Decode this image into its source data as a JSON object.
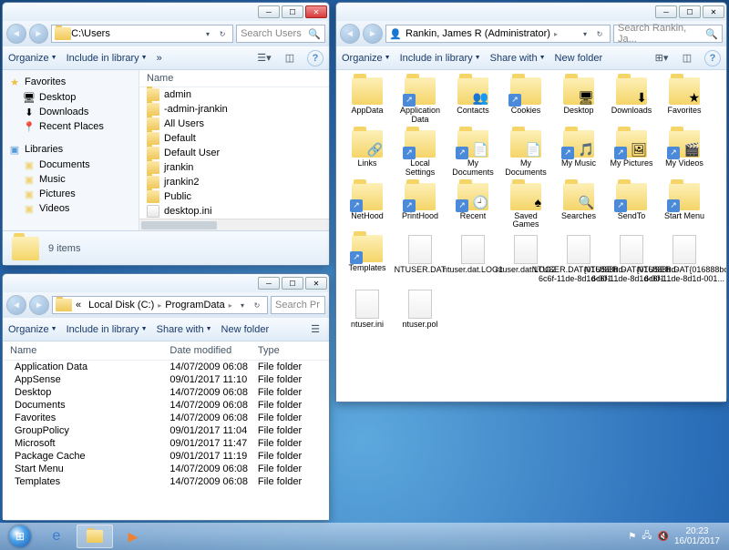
{
  "win1": {
    "address": "C:\\Users",
    "search_placeholder": "Search Users",
    "toolbar": {
      "organize": "Organize",
      "include": "Include in library",
      "more": "»"
    },
    "nav": {
      "favorites": "Favorites",
      "fav_items": [
        "Desktop",
        "Downloads",
        "Recent Places"
      ],
      "libraries": "Libraries",
      "lib_items": [
        "Documents",
        "Music",
        "Pictures",
        "Videos"
      ]
    },
    "header": "Name",
    "items": [
      "admin",
      "-admin-jrankin",
      "All Users",
      "Default",
      "Default User",
      "jrankin",
      "jrankin2",
      "Public",
      "desktop.ini"
    ],
    "status": "9 items"
  },
  "win2": {
    "crumbs": [
      "Local Disk (C:)",
      "ProgramData"
    ],
    "search_placeholder": "Search Pr",
    "toolbar": {
      "organize": "Organize",
      "include": "Include in library",
      "share": "Share with",
      "newfolder": "New folder"
    },
    "columns": [
      "Name",
      "Date modified",
      "Type"
    ],
    "rows": [
      {
        "n": "Application Data",
        "d": "14/07/2009 06:08",
        "t": "File folder"
      },
      {
        "n": "AppSense",
        "d": "09/01/2017 11:10",
        "t": "File folder"
      },
      {
        "n": "Desktop",
        "d": "14/07/2009 06:08",
        "t": "File folder"
      },
      {
        "n": "Documents",
        "d": "14/07/2009 06:08",
        "t": "File folder"
      },
      {
        "n": "Favorites",
        "d": "14/07/2009 06:08",
        "t": "File folder"
      },
      {
        "n": "GroupPolicy",
        "d": "09/01/2017 11:04",
        "t": "File folder"
      },
      {
        "n": "Microsoft",
        "d": "09/01/2017 11:47",
        "t": "File folder"
      },
      {
        "n": "Package Cache",
        "d": "09/01/2017 11:19",
        "t": "File folder"
      },
      {
        "n": "Start Menu",
        "d": "14/07/2009 06:08",
        "t": "File folder"
      },
      {
        "n": "Templates",
        "d": "14/07/2009 06:08",
        "t": "File folder"
      }
    ]
  },
  "win3": {
    "crumbs": [
      "Rankin, James R (Administrator)"
    ],
    "search_placeholder": "Search Rankin, Ja...",
    "toolbar": {
      "organize": "Organize",
      "include": "Include in library",
      "share": "Share with",
      "newfolder": "New folder"
    },
    "items": [
      {
        "n": "AppData",
        "k": "folder"
      },
      {
        "n": "Application Data",
        "k": "folder",
        "s": true
      },
      {
        "n": "Contacts",
        "k": "folder",
        "b": "👥"
      },
      {
        "n": "Cookies",
        "k": "folder",
        "s": true
      },
      {
        "n": "Desktop",
        "k": "folder",
        "b": "🖥"
      },
      {
        "n": "Downloads",
        "k": "folder",
        "b": "⬇"
      },
      {
        "n": "Favorites",
        "k": "folder",
        "b": "★"
      },
      {
        "n": "Links",
        "k": "folder",
        "b": "🔗"
      },
      {
        "n": "Local Settings",
        "k": "folder",
        "s": true
      },
      {
        "n": "My Documents",
        "k": "folder",
        "s": true,
        "b": "📄"
      },
      {
        "n": "My Documents",
        "k": "folder",
        "b": "📄"
      },
      {
        "n": "My Music",
        "k": "folder",
        "s": true,
        "b": "🎵"
      },
      {
        "n": "My Pictures",
        "k": "folder",
        "s": true,
        "b": "🖼"
      },
      {
        "n": "My Videos",
        "k": "folder",
        "s": true,
        "b": "🎬"
      },
      {
        "n": "NetHood",
        "k": "folder",
        "s": true
      },
      {
        "n": "PrintHood",
        "k": "folder",
        "s": true
      },
      {
        "n": "Recent",
        "k": "folder",
        "s": true,
        "b": "🕘"
      },
      {
        "n": "Saved Games",
        "k": "folder",
        "b": "♠"
      },
      {
        "n": "Searches",
        "k": "folder",
        "b": "🔍"
      },
      {
        "n": "SendTo",
        "k": "folder",
        "s": true
      },
      {
        "n": "Start Menu",
        "k": "folder",
        "s": true
      },
      {
        "n": "Templates",
        "k": "folder",
        "s": true
      },
      {
        "n": "NTUSER.DAT",
        "k": "file"
      },
      {
        "n": "ntuser.dat.LOG1",
        "k": "file"
      },
      {
        "n": "ntuser.dat.LOG2",
        "k": "file"
      },
      {
        "n": "NTUSER.DAT{016888bd-6c6f-11de-8d1d-001...",
        "k": "file"
      },
      {
        "n": "NTUSER.DAT{016888bd-6c6f-11de-8d1d-001...",
        "k": "file"
      },
      {
        "n": "NTUSER.DAT{016888bd-6c6f-11de-8d1d-001...",
        "k": "file"
      },
      {
        "n": "ntuser.ini",
        "k": "file"
      },
      {
        "n": "ntuser.pol",
        "k": "file"
      }
    ]
  },
  "taskbar": {
    "time": "20:23",
    "date": "16/01/2017"
  }
}
